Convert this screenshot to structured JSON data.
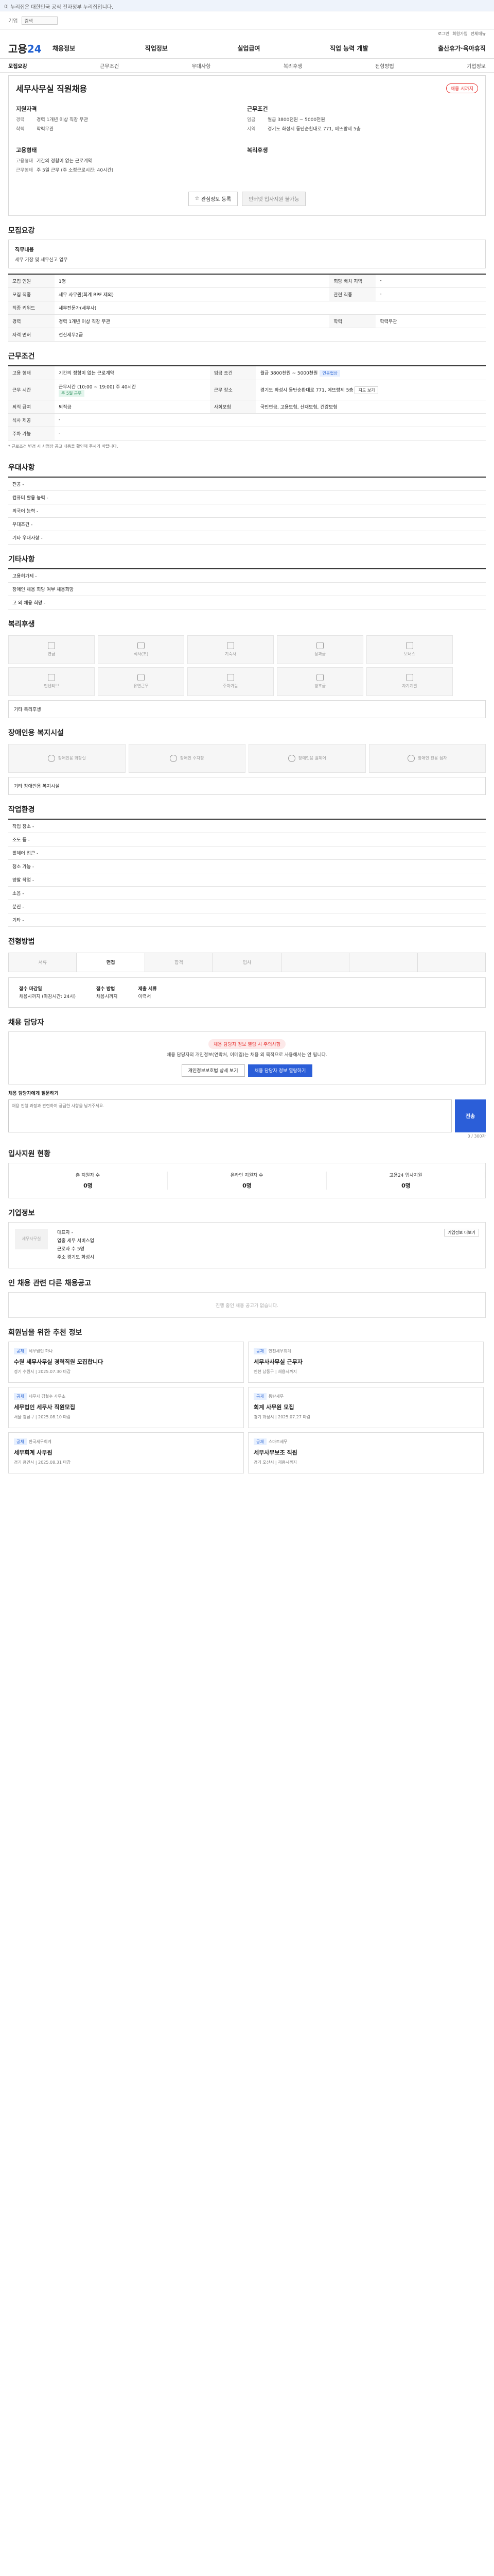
{
  "topbar": {
    "notice": "이 누리집은 대한민국 공식 전자정부 누리집입니다.",
    "link": "기업"
  },
  "header": {
    "search_label": "검색",
    "login": "로그인",
    "signup": "회원가입",
    "menu": "전체메뉴"
  },
  "gnb": {
    "logo_a": "고용",
    "logo_b": "24",
    "menus": [
      "채용정보",
      "직업정보",
      "실업급여",
      "직업 능력 개발",
      "출산휴가·육아휴직"
    ]
  },
  "tabs": [
    "모집요강",
    "근무조건",
    "우대사항",
    "복리후생",
    "전형방법",
    "기업정보"
  ],
  "summary": {
    "title": "세무사무실 직원채용",
    "badge": "채용 시까지",
    "qual_head": "지원자격",
    "exp_k": "경력",
    "exp_v": "경력 1개년 이상 직장 무관",
    "edu_k": "학력",
    "edu_v": "학력무관",
    "work_head": "근무조건",
    "wage_k": "임금",
    "wage_v": "월급 3800천원 ~ 5000천원",
    "loc_k": "지역",
    "loc_v": "경기도 화성시 동탄순환대로 771, 에뜨랑제 5층",
    "type_head": "고용형태",
    "type_k": "고용형태",
    "type_v": "기간의 정함이 없는 근로계약",
    "hours_k": "근무형태",
    "hours_v": "주 5일 근무 (주 소정근로시간: 40시간)",
    "benefit_head": "복리후생",
    "btn_bookmark": "관심정보 등록",
    "btn_apply": "인터넷 입사지원 불가능"
  },
  "recruit": {
    "title": "모집요강",
    "duty_h": "직무내용",
    "duty_v": "세무 기장 및 세무신고 업무",
    "rows": [
      {
        "k": "모집 인원",
        "v": "1명",
        "k2": "희망 배치 지역",
        "v2": "-"
      },
      {
        "k": "모집 직종",
        "v": "세무 사무원(회계 BPF 제외)",
        "k2": "관련 직종",
        "v2": "-"
      },
      {
        "k": "직종 키워드",
        "v": "세무전문가(세무사)",
        "k2": "",
        "v2": ""
      },
      {
        "k": "경력",
        "v": "경력 1개년 이상 직장 무관",
        "k2": "학력",
        "v2": "학력무관"
      },
      {
        "k": "자격 면허",
        "v": "전산세무2급",
        "k2": "",
        "v2": ""
      }
    ]
  },
  "work": {
    "title": "근무조건",
    "rows": [
      {
        "k": "고용 형태",
        "v": "기간의 정함이 없는 근로계약",
        "k2": "임금 조건",
        "v2": "월급 3800천원 ~ 5000천원"
      },
      {
        "k": "근무 시간",
        "v": "주 5일 근무",
        "k2": "근무 장소",
        "v2": "경기도 화성시 동탄순환대로 771, 에뜨랑제 5층"
      },
      {
        "k": "퇴직 급여",
        "v": "퇴직금",
        "k2": "사회보험",
        "v2": "국민연금, 고용보험, 산재보험, 건강보험"
      },
      {
        "k": "식사 제공",
        "v": "-",
        "k2": "",
        "v2": ""
      },
      {
        "k": "주차 가능",
        "v": "-",
        "k2": "",
        "v2": ""
      }
    ],
    "wage_tag": "연봉협상",
    "time_v": "근무시간 (10:00 ~ 19:00) 주 40시간",
    "time_tag": "주 5일 근무",
    "map_btn": "지도 보기",
    "note": "* 근로조건 변경 시 사업장 공고 내용을 확인해 주시기 바랍니다."
  },
  "pref": {
    "title": "우대사항",
    "rows": [
      "전공 -",
      "컴퓨터 활용 능력 -",
      "외국어 능력 -",
      "우대조건 -",
      "기타 우대사항 -"
    ]
  },
  "etc": {
    "title": "기타사항",
    "rows": [
      "고용허가제 -",
      "장애인 채용 희망 여부 채용희망",
      "고 외 채용 희망 -"
    ]
  },
  "welfare": {
    "title": "복리후생",
    "items": [
      "연금",
      "식사(조)",
      "기숙사",
      "성과급",
      "보너스",
      "인센티브",
      "유연근무",
      "주차가능",
      "경조금",
      "자기계발"
    ],
    "extra": "기타 복리후생"
  },
  "facility": {
    "title": "장애인용 복지시설",
    "items": [
      "장애인용 화장실",
      "장애인 주차장",
      "장애인용 휠체어",
      "장애인 전용 점자"
    ],
    "extra": "기타 장애인용 복지시설"
  },
  "env": {
    "title": "작업환경",
    "rows": [
      "작업 장소 -",
      "조도 등 -",
      "휠체어 접근 -",
      "청소 가능 -",
      "양팔 작업 -",
      "소음 -",
      "분진 -",
      "기타 -"
    ]
  },
  "process": {
    "title": "전형방법",
    "steps": [
      "서류",
      "면접",
      "합격",
      "입사",
      "",
      "",
      ""
    ],
    "how_h": "접수 마감일",
    "how_v": "채용시까지 (마감시간: 24시)",
    "method_h": "접수 방법",
    "method_v": "채용시까지",
    "doc_h": "제출 서류",
    "doc_v": "이력서"
  },
  "consult": {
    "title": "채용 담당자",
    "warn": "채용 담당자 정보 열람 시 주의사항",
    "desc": "채용 담당자의 개인정보(연락처, 이메일)는 채용 외 목적으로 사용해서는 안 됩니다.",
    "btn1": "개인정보보호법 상세 보기",
    "btn2": "채용 담당자 정보 열람하기",
    "q_label": "채용 담당자에게 질문하기",
    "q_placeholder": "채용 진행 과정과 관련하여 궁금한 사항을 남겨주세요.",
    "send": "전송",
    "limit": "0 / 300자"
  },
  "stats": {
    "title": "입사지원 현황",
    "items": [
      {
        "t": "총 지원자 수",
        "v": "0명"
      },
      {
        "t": "온라인 지원자 수",
        "v": "0명"
      },
      {
        "t": "고용24 입사지원",
        "v": "0명"
      }
    ]
  },
  "agency": {
    "title": "기업정보",
    "name": "세무사무실",
    "rows": [
      "대표자 -",
      "업종 세무 서비스업",
      "근로자 수 5명",
      "주소 경기도 화성시"
    ],
    "btn": "기업정보 더보기"
  },
  "related": {
    "title": "인 채용 관련 다른 채용공고",
    "empty": "진행 중인 채용 공고가 없습니다."
  },
  "recommend": {
    "title": "회원님을 위한 추천 정보",
    "jobs": [
      {
        "badge": "공채",
        "co": "세무법인 하나",
        "title": "수원 세무사무실 경력직원 모집합니다",
        "m": "경기 수원시 | 2025.07.30 마감"
      },
      {
        "badge": "공채",
        "co": "인천세무회계",
        "title": "세무사사무실 근무자",
        "m": "인천 남동구 | 채용시까지"
      },
      {
        "badge": "공채",
        "co": "세무사 김철수 사무소",
        "title": "세무법인 세무사 직원모집",
        "m": "서울 강남구 | 2025.08.10 마감"
      },
      {
        "badge": "공채",
        "co": "동탄세무",
        "title": "회계 사무원 모집",
        "m": "경기 화성시 | 2025.07.27 마감"
      },
      {
        "badge": "공채",
        "co": "한국세무회계",
        "title": "세무회계 사무원",
        "m": "경기 용인시 | 2025.08.31 마감"
      },
      {
        "badge": "공채",
        "co": "스마트세무",
        "title": "세무사무보조 직원",
        "m": "경기 오산시 | 채용시까지"
      }
    ]
  }
}
